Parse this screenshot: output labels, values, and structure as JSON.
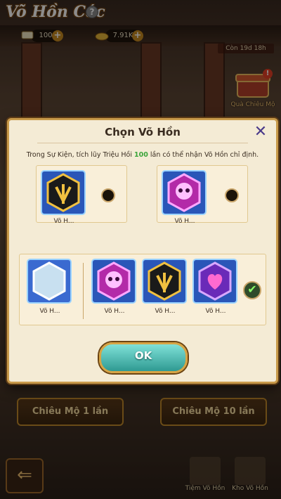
{
  "app": {
    "title": "Võ Hồn Các",
    "help_glyph": "?"
  },
  "resources": [
    {
      "name": "scroll",
      "value": "100",
      "plus": "+"
    },
    {
      "name": "gold",
      "value": "7.91K",
      "plus": "+"
    }
  ],
  "timer": "Còn 19d 18h",
  "chest": {
    "label": "Quà Chiêu Mộ",
    "badge": "!"
  },
  "bottom": {
    "summon1": "Chiêu Mộ 1 lần",
    "summon10": "Chiêu Mộ 10 lần",
    "shop": "Tiệm Võ Hồn",
    "storage": "Kho Võ Hồn",
    "back_glyph": "⇐"
  },
  "dialog": {
    "title": "Chọn Võ Hồn",
    "close_glyph": "✕",
    "desc_before": "Trong Sự Kiện, tích lũy Triệu Hồi ",
    "desc_highlight": "100",
    "desc_after": " lần có thể nhận Võ Hồn chỉ định.",
    "options_top": [
      {
        "label": "Võ H...",
        "icon": "golden-trident-icon",
        "selected": false
      },
      {
        "label": "Võ H...",
        "icon": "pink-skull-icon",
        "selected": false
      }
    ],
    "group": {
      "slots": [
        {
          "label": "Võ H...",
          "icon": "crystal-hexagon-icon"
        },
        {
          "label": "Võ H...",
          "icon": "pink-skull-icon"
        },
        {
          "label": "Võ H...",
          "icon": "golden-trident-icon"
        },
        {
          "label": "Võ H...",
          "icon": "purple-heart-icon"
        }
      ],
      "selected": true,
      "check_glyph": "✔"
    },
    "ok_label": "OK"
  },
  "colors": {
    "highlight": "#3aa43a",
    "frame": "#c89a4a",
    "ok": "#4fb8b0"
  }
}
